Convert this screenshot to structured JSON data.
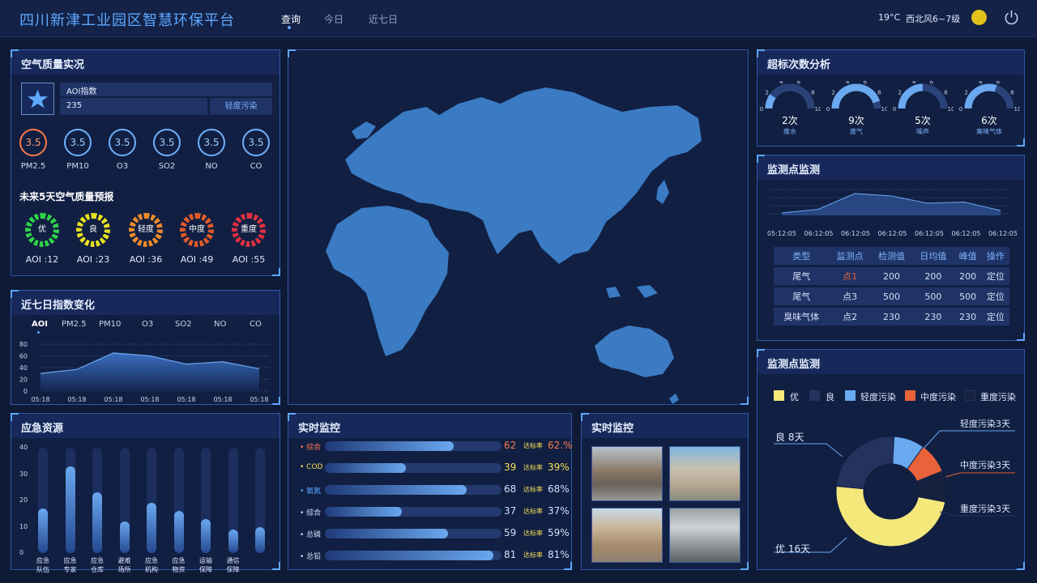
{
  "header": {
    "title": "四川新津工业园区智慧环保平台",
    "tabs": [
      "查询",
      "今日",
      "近七日"
    ],
    "temp": "19°C",
    "wind": "西北风6~7级"
  },
  "air": {
    "title": "空气质量实况",
    "aqi_label": "AOI指数",
    "aqi_value": "235",
    "aqi_level": "轻度污染",
    "pollutants": [
      {
        "name": "PM2.5",
        "value": "3.5"
      },
      {
        "name": "PM10",
        "value": "3.5"
      },
      {
        "name": "O3",
        "value": "3.5"
      },
      {
        "name": "SO2",
        "value": "3.5"
      },
      {
        "name": "NO",
        "value": "3.5"
      },
      {
        "name": "CO",
        "value": "3.5"
      }
    ],
    "forecast_title": "未来5天空气质量预报",
    "forecast": [
      {
        "level": "优",
        "aqi": "AOI :12",
        "color": "#2fd24a"
      },
      {
        "level": "良",
        "aqi": "AOI :23",
        "color": "#e8e020"
      },
      {
        "level": "轻度",
        "aqi": "AOI :36",
        "color": "#f08a2a"
      },
      {
        "level": "中度",
        "aqi": "AOI :49",
        "color": "#e25a2a"
      },
      {
        "level": "重度",
        "aqi": "AOI :55",
        "color": "#e23040"
      }
    ]
  },
  "seven_day": {
    "title": "近七日指数变化",
    "tabs": [
      "AOI",
      "PM2.5",
      "PM10",
      "O3",
      "SO2",
      "NO",
      "CO"
    ],
    "chart_data": {
      "type": "area",
      "x": [
        "05:18",
        "05:18",
        "05:18",
        "05:18",
        "05:18",
        "05:18",
        "05:18"
      ],
      "values": [
        30,
        37,
        65,
        60,
        46,
        50,
        38
      ],
      "ylim": [
        0,
        80
      ],
      "yticks": [
        0,
        20,
        40,
        60,
        80
      ]
    }
  },
  "emergency": {
    "title": "应急资源",
    "chart_data": {
      "type": "bar",
      "categories": [
        "应急队伍",
        "应急专家",
        "应急仓库",
        "避难场所",
        "应急机构",
        "应急物资",
        "运输保障",
        "通信保障"
      ],
      "labels": [
        [
          "应急",
          "队伍"
        ],
        [
          "应急",
          "专家"
        ],
        [
          "应急",
          "仓库"
        ],
        [
          "避难",
          "场所"
        ],
        [
          "应急",
          "机构"
        ],
        [
          "应急",
          "物资"
        ],
        [
          "运输",
          "保障"
        ],
        [
          "通信",
          "保障"
        ]
      ],
      "values": [
        17,
        33,
        23,
        12,
        19,
        16,
        13,
        9,
        10
      ],
      "ylim": [
        0,
        40
      ],
      "yticks": [
        0,
        10,
        20,
        30,
        40
      ]
    }
  },
  "realtime": {
    "title": "实时监控",
    "rate_label": "达标率",
    "rows": [
      {
        "name": "综合",
        "value": "62",
        "rate": "62.%",
        "pct": 62,
        "accent": "#ff7a4d"
      },
      {
        "name": "COD",
        "value": "39",
        "rate": "39%",
        "pct": 39,
        "accent": "#f5e15a"
      },
      {
        "name": "氨氮",
        "value": "68",
        "rate": "68%",
        "pct": 68,
        "accent": "#5ea8ff"
      },
      {
        "name": "综合",
        "value": "37",
        "rate": "37%",
        "pct": 37,
        "accent": "#cfe0ff"
      },
      {
        "name": "总磷",
        "value": "59",
        "rate": "59%",
        "pct": 59,
        "accent": "#cfe0ff"
      },
      {
        "name": "总铅",
        "value": "81",
        "rate": "81%",
        "pct": 81,
        "accent": "#cfe0ff"
      }
    ]
  },
  "video": {
    "title": "实时监控"
  },
  "exceed": {
    "title": "超标次数分析",
    "scale": [
      "0",
      "2",
      "4",
      "6",
      "8",
      "10"
    ],
    "gauges": [
      {
        "count": "2",
        "unit": "次",
        "label": "废水",
        "value": 2
      },
      {
        "count": "9",
        "unit": "次",
        "label": "废气",
        "value": 9
      },
      {
        "count": "5",
        "unit": "次",
        "label": "噪声",
        "value": 5
      },
      {
        "count": "6",
        "unit": "次",
        "label": "臭味气体",
        "value": 6
      }
    ]
  },
  "monitor": {
    "title": "监测点监测",
    "chart_data": {
      "type": "area",
      "x": [
        "05:12:05",
        "06:12:05",
        "06:12:05",
        "06:12:05",
        "06:12:05",
        "06:12:05",
        "06:12:05"
      ],
      "values": [
        0.1,
        0.25,
        0.9,
        0.8,
        0.5,
        0.55,
        0.2
      ]
    },
    "columns": [
      "类型",
      "监测点",
      "检测值",
      "日均值",
      "峰值",
      "操作"
    ],
    "rows": [
      [
        "尾气",
        "点1",
        "200",
        "200",
        "200",
        "定位"
      ],
      [
        "尾气",
        "点3",
        "500",
        "500",
        "500",
        "定位"
      ],
      [
        "臭味气体",
        "点2",
        "230",
        "230",
        "230",
        "定位"
      ]
    ]
  },
  "pie": {
    "title": "监测点监测",
    "legend": [
      {
        "name": "优",
        "color": "#f5e87a"
      },
      {
        "name": "良",
        "color": "#24335e"
      },
      {
        "name": "轻度污染",
        "color": "#6aa8f0"
      },
      {
        "name": "中度污染",
        "color": "#e8623a"
      },
      {
        "name": "重度污染",
        "color": "#16203f"
      }
    ],
    "chart_data": {
      "type": "pie",
      "categories": [
        "优",
        "良",
        "轻度污染",
        "中度污染",
        "重度污染"
      ],
      "values": [
        16,
        8,
        3,
        3,
        3
      ]
    },
    "labels": {
      "good": "良  8天",
      "excellent": "优  16天",
      "light": "轻度污染3天",
      "moderate": "中度污染3天",
      "severe": "重度污染3天"
    }
  }
}
